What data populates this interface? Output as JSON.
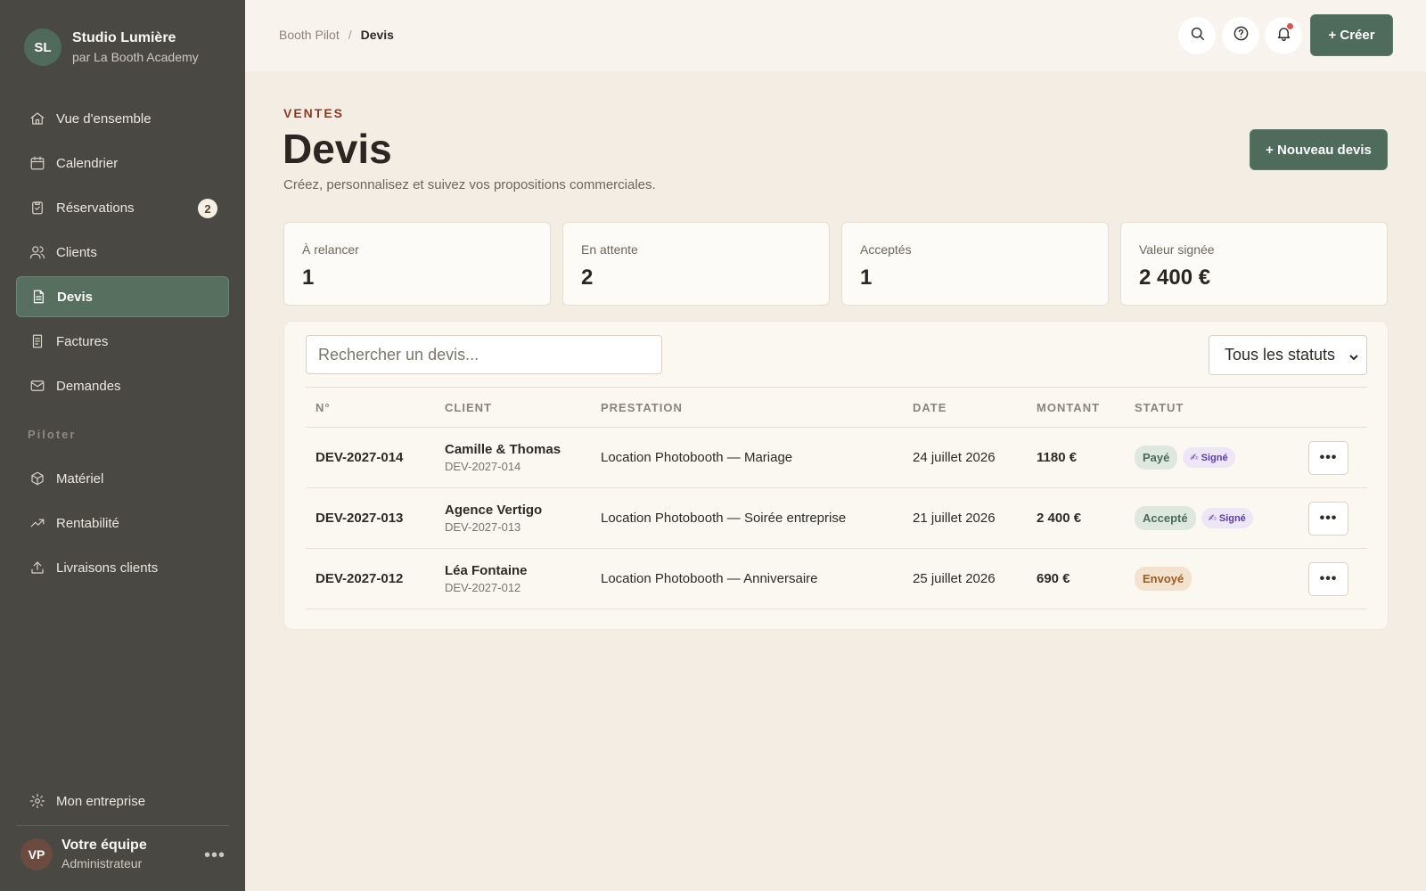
{
  "brand": {
    "initials": "SL",
    "name": "Studio Lumière",
    "subtitle": "par La Booth Academy"
  },
  "nav": {
    "items": [
      {
        "label": "Vue d'ensemble",
        "icon": "home-icon"
      },
      {
        "label": "Calendrier",
        "icon": "calendar-icon"
      },
      {
        "label": "Réservations",
        "icon": "clipboard-check-icon",
        "badge": "2"
      },
      {
        "label": "Clients",
        "icon": "users-icon"
      },
      {
        "label": "Devis",
        "icon": "document-icon",
        "active": true
      },
      {
        "label": "Factures",
        "icon": "receipt-icon"
      },
      {
        "label": "Demandes",
        "icon": "mail-icon"
      }
    ],
    "section_label": "Piloter",
    "section_items": [
      {
        "label": "Matériel",
        "icon": "box-icon"
      },
      {
        "label": "Rentabilité",
        "icon": "trending-up-icon"
      },
      {
        "label": "Livraisons clients",
        "icon": "upload-icon"
      }
    ],
    "settings": {
      "label": "Mon entreprise",
      "icon": "gear-icon"
    }
  },
  "user": {
    "initials": "VP",
    "name": "Votre équipe",
    "role": "Administrateur",
    "more": "•••"
  },
  "topbar": {
    "breadcrumb_root": "Booth Pilot",
    "breadcrumb_sep": "/",
    "breadcrumb_current": "Devis",
    "create_label": "+ Créer"
  },
  "header": {
    "eyebrow": "VENTES",
    "title": "Devis",
    "subtitle": "Créez, personnalisez et suivez vos propositions commerciales.",
    "new_button": "+ Nouveau devis"
  },
  "stats": [
    {
      "label": "À relancer",
      "value": "1"
    },
    {
      "label": "En attente",
      "value": "2"
    },
    {
      "label": "Acceptés",
      "value": "1"
    },
    {
      "label": "Valeur signée",
      "value": "2 400 €"
    }
  ],
  "filters": {
    "search_placeholder": "Rechercher un devis...",
    "status_value": "Tous les statuts"
  },
  "table": {
    "columns": [
      "N°",
      "CLIENT",
      "PRESTATION",
      "DATE",
      "MONTANT",
      "STATUT"
    ],
    "rows": [
      {
        "number": "DEV-2027-014",
        "client": "Camille & Thomas",
        "client_ref": "DEV-2027-014",
        "service": "Location Photobooth — Mariage",
        "date": "24 juillet 2026",
        "amount": "1180 €",
        "status": "Payé",
        "signed": "✍ Signé",
        "more": "•••"
      },
      {
        "number": "DEV-2027-013",
        "client": "Agence Vertigo",
        "client_ref": "DEV-2027-013",
        "service": "Location Photobooth — Soirée entreprise",
        "date": "21 juillet 2026",
        "amount": "2 400 €",
        "status": "Accepté",
        "signed": "✍ Signé",
        "more": "•••"
      },
      {
        "number": "DEV-2027-012",
        "client": "Léa Fontaine",
        "client_ref": "DEV-2027-012",
        "service": "Location Photobooth — Anniversaire",
        "date": "25 juillet 2026",
        "amount": "690 €",
        "status": "Envoyé",
        "signed": "",
        "more": "•••"
      }
    ]
  },
  "colors": {
    "accent": "#4e6b5c",
    "sidebar": "#4a4843",
    "eyebrow": "#8a3b22",
    "notification_dot": "#d9534f"
  }
}
